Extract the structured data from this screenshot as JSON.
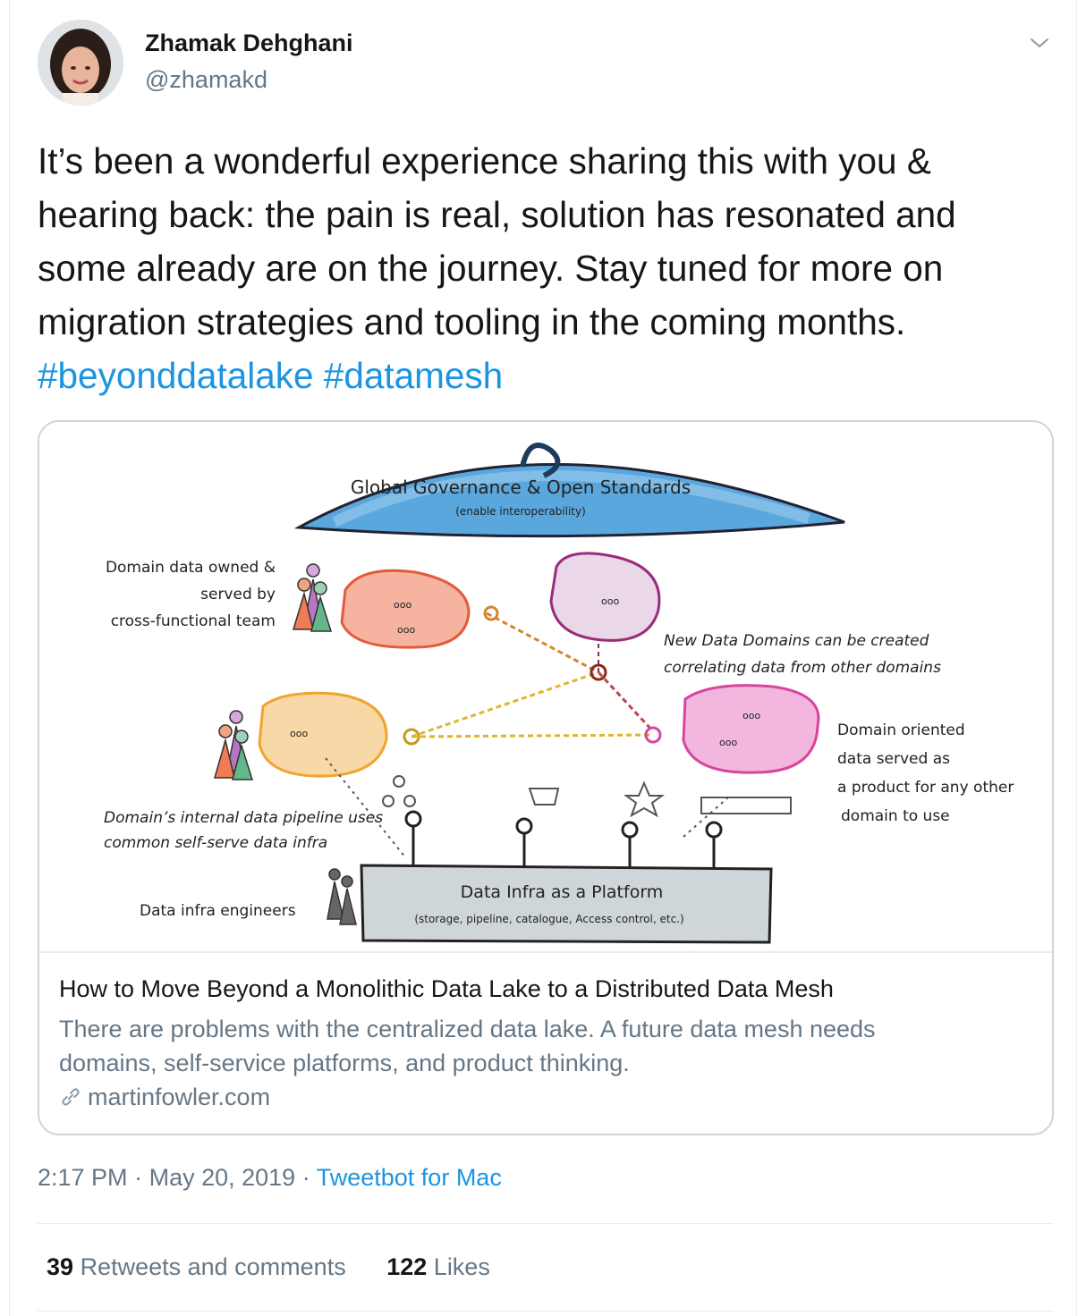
{
  "author": {
    "name": "Zhamak Dehghani",
    "handle": "@zhamakd"
  },
  "tweet": {
    "lines": [
      "It’s been a wonderful experience sharing this with you &",
      "hearing back: the pain is real, solution has resonated and",
      "some already are on the journey. Stay tuned for more on",
      "migration strategies and tooling in the coming months."
    ],
    "hashtags": [
      "#beyonddatalake",
      "#datamesh"
    ]
  },
  "card": {
    "diagram": {
      "governance_title": "Global Governance & Open Standards",
      "governance_sub": "(enable interoperability)",
      "domain_owned_1": "Domain data owned &",
      "domain_owned_2": "served by",
      "domain_owned_3": "cross-functional team",
      "new_domains_1": "New Data Domains can be created",
      "new_domains_2": "correlating data from other domains",
      "oriented_1": "Domain oriented",
      "oriented_2": "data served as",
      "oriented_3": "a product for any other",
      "oriented_4": "domain to use",
      "pipeline_1": "Domain’s internal data pipeline uses",
      "pipeline_2": "common self-serve data infra",
      "infra_engineers": "Data infra engineers",
      "platform_title": "Data Infra as a Platform",
      "platform_sub": "(storage, pipeline, catalogue, Access control, etc.)"
    },
    "title": "How to Move Beyond a Monolithic Data Lake to a Distributed Data Mesh",
    "description_lines": [
      "There are problems with the centralized data lake. A future data mesh needs",
      "domains, self-service platforms, and product thinking."
    ],
    "domain": "martinfowler.com"
  },
  "meta": {
    "time": "2:17 PM",
    "date": "May 20, 2019",
    "separator": "·",
    "source": "Tweetbot for Mac"
  },
  "stats": {
    "retweets_count": "39",
    "retweets_label": "Retweets and comments",
    "likes_count": "122",
    "likes_label": "Likes"
  },
  "colors": {
    "link": "#1b95e0",
    "secondary_text": "#657786",
    "border": "#ccd6dd"
  }
}
